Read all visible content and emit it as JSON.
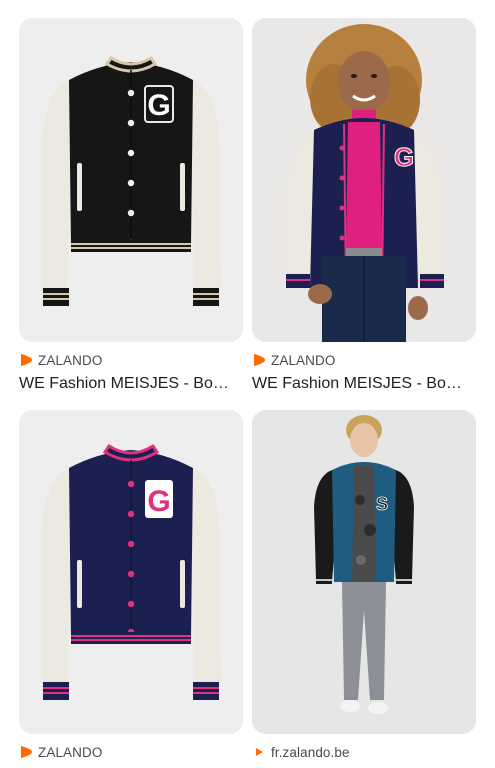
{
  "results": [
    {
      "source": "ZALANDO",
      "favicon": "zalando-icon",
      "title": "WE Fashion MEISJES - Bo…",
      "image": "black-varsity-jacket-white-sleeves"
    },
    {
      "source": "ZALANDO",
      "favicon": "zalando-icon",
      "title": "WE Fashion MEISJES - Bo…",
      "image": "girl-wearing-navy-pink-varsity-jacket"
    },
    {
      "source": "ZALANDO",
      "favicon": "zalando-icon",
      "title": "",
      "image": "navy-varsity-jacket-pink-trim"
    },
    {
      "source": "fr.zalando.be",
      "favicon": "zalando-icon",
      "title": "",
      "image": "boy-wearing-blue-varsity-jacket"
    }
  ],
  "colors": {
    "zalando_orange": "#ff6900",
    "navy": "#1c2050",
    "pink": "#e0307e",
    "black_body": "#161616",
    "cream": "#ece9e0",
    "teal_blue": "#1f5d80"
  }
}
